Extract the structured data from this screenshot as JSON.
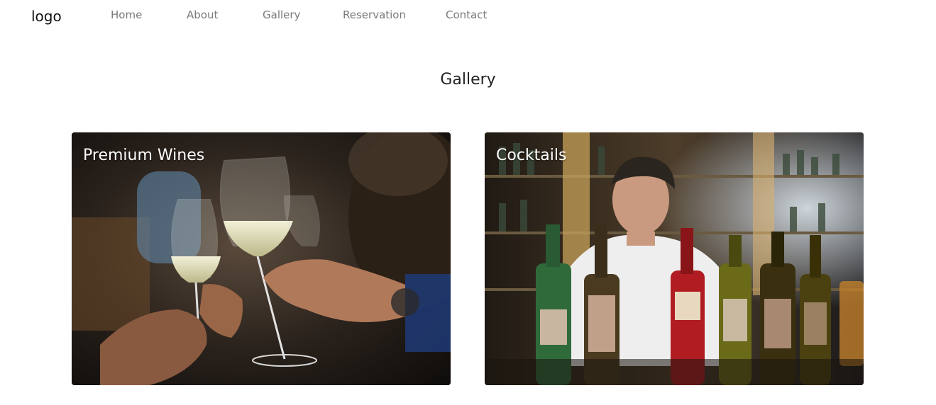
{
  "nav": {
    "logo": "logo",
    "links": [
      "Home",
      "About",
      "Gallery",
      "Reservation",
      "Contact"
    ]
  },
  "gallery": {
    "title": "Gallery",
    "cards": [
      {
        "title": "Premium Wines"
      },
      {
        "title": "Cocktails"
      }
    ]
  },
  "colors": {
    "nav_link": "#7a7a7a",
    "text": "#222222",
    "card_title": "#ffffff"
  }
}
